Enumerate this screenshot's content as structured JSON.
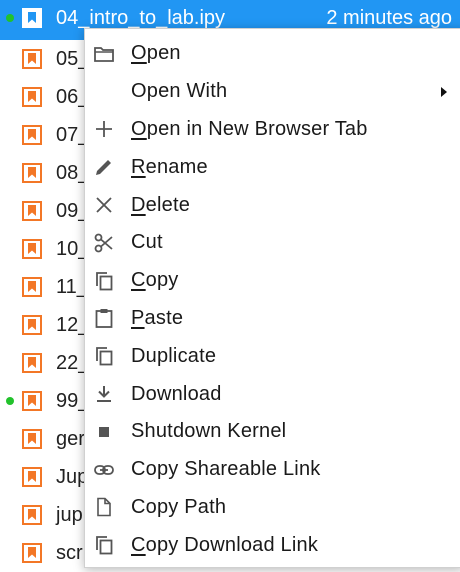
{
  "files": [
    {
      "name": "04_intro_to_lab.ipy",
      "time": "2 minutes ago",
      "running": true,
      "selected": true
    },
    {
      "name": "05_",
      "running": false
    },
    {
      "name": "06_",
      "running": false
    },
    {
      "name": "07_",
      "running": false
    },
    {
      "name": "08_",
      "running": false
    },
    {
      "name": "09_",
      "running": false
    },
    {
      "name": "10_",
      "running": false
    },
    {
      "name": "11_",
      "running": false
    },
    {
      "name": "12_",
      "running": false
    },
    {
      "name": "22_",
      "running": false
    },
    {
      "name": "99_",
      "running": true
    },
    {
      "name": "ger",
      "running": false
    },
    {
      "name": "Jup",
      "running": false
    },
    {
      "name": "jup",
      "running": false
    },
    {
      "name": "scr",
      "running": false
    }
  ],
  "menu": {
    "items": [
      {
        "mnemonic": "O",
        "rest": "pen",
        "icon": "folder-icon"
      },
      {
        "mnemonic": "",
        "rest": "Open With",
        "icon": "",
        "submenu": true
      },
      {
        "mnemonic": "O",
        "rest": "pen in New Browser Tab",
        "icon": "plus-icon"
      },
      {
        "mnemonic": "R",
        "rest": "ename",
        "icon": "pencil-icon"
      },
      {
        "mnemonic": "D",
        "rest": "elete",
        "icon": "close-icon"
      },
      {
        "mnemonic": "",
        "rest": "Cut",
        "icon": "scissors-icon"
      },
      {
        "mnemonic": "C",
        "rest": "opy",
        "icon": "copy-icon"
      },
      {
        "mnemonic": "P",
        "rest": "aste",
        "icon": "clipboard-icon"
      },
      {
        "mnemonic": "",
        "rest": "Duplicate",
        "icon": "duplicate-icon"
      },
      {
        "mnemonic": "",
        "rest": "Download",
        "icon": "download-icon"
      },
      {
        "mnemonic": "",
        "rest": "Shutdown Kernel",
        "icon": "stop-icon"
      },
      {
        "mnemonic": "",
        "rest": "Copy Shareable Link",
        "icon": "link-icon"
      },
      {
        "mnemonic": "",
        "rest": "Copy Path",
        "icon": "file-icon"
      },
      {
        "mnemonic": "C",
        "rest": "opy Download Link",
        "icon": "copy-link-icon"
      }
    ]
  },
  "colors": {
    "selection": "#2196f3",
    "notebook_icon": "#f37726",
    "running_dot": "#22c22c"
  }
}
